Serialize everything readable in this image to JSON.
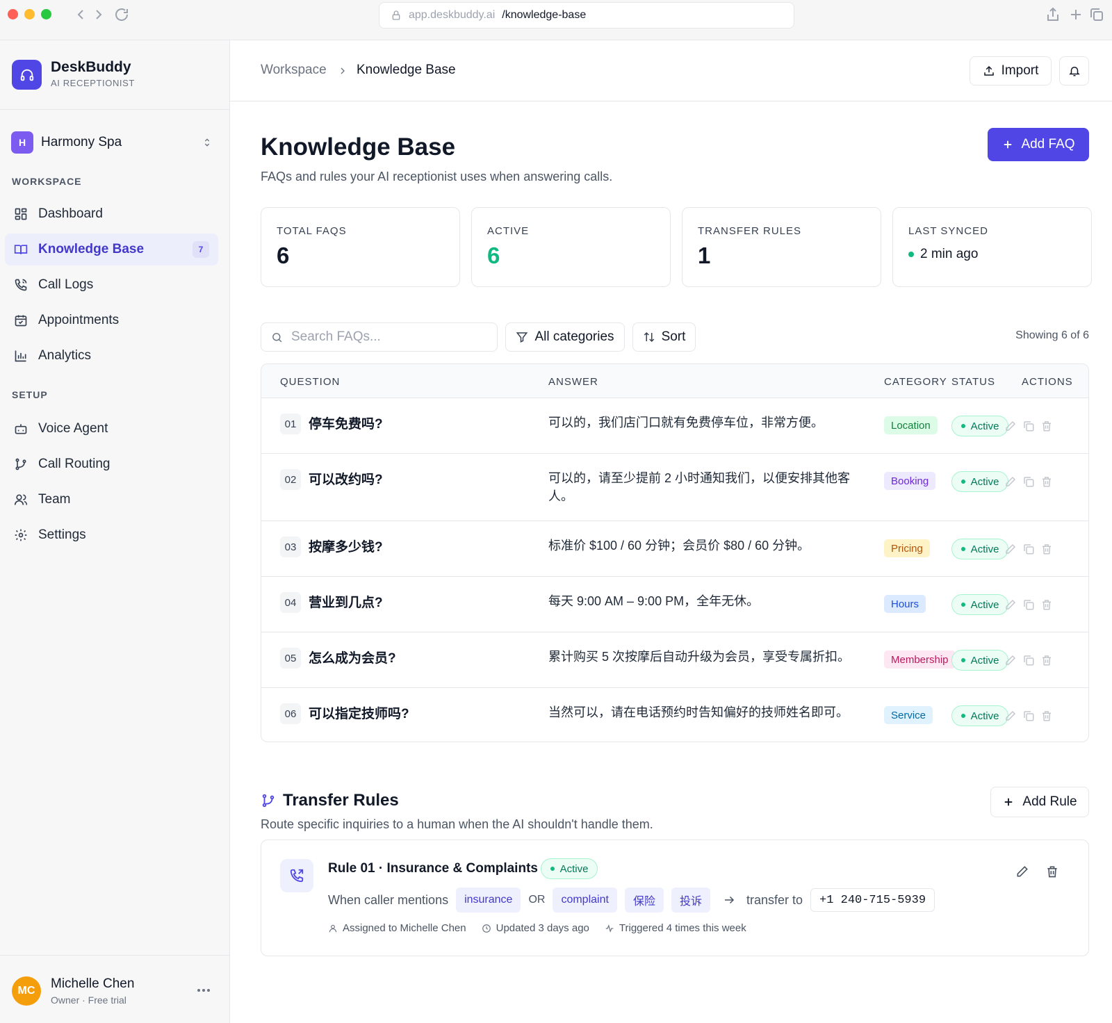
{
  "browser": {
    "url_host": "app.deskbuddy.ai",
    "url_path": "/knowledge-base"
  },
  "sidebar": {
    "brand": {
      "name": "DeskBuddy",
      "subtitle": "AI RECEPTIONIST"
    },
    "org": {
      "initial": "H",
      "name": "Harmony Spa"
    },
    "workspace_label": "WORKSPACE",
    "setup_label": "SETUP",
    "workspace_items": [
      {
        "label": "Dashboard",
        "icon": "dashboard-icon"
      },
      {
        "label": "Knowledge Base",
        "icon": "book-icon",
        "badge": "7",
        "active": true
      },
      {
        "label": "Call Logs",
        "icon": "phone-icon"
      },
      {
        "label": "Appointments",
        "icon": "calendar-icon"
      },
      {
        "label": "Analytics",
        "icon": "bar-chart-icon"
      }
    ],
    "setup_items": [
      {
        "label": "Voice Agent",
        "icon": "bot-icon"
      },
      {
        "label": "Call Routing",
        "icon": "git-branch-icon"
      },
      {
        "label": "Team",
        "icon": "users-icon"
      },
      {
        "label": "Settings",
        "icon": "gear-icon"
      }
    ],
    "user": {
      "initials": "MC",
      "name": "Michelle Chen",
      "role": "Owner · Free trial"
    }
  },
  "header": {
    "breadcrumb": [
      "Workspace",
      "Knowledge Base"
    ],
    "import_label": "Import"
  },
  "page": {
    "title": "Knowledge Base",
    "subtitle": "FAQs and rules your AI receptionist uses when answering calls.",
    "add_faq_label": "Add FAQ"
  },
  "stats": [
    {
      "label": "TOTAL FAQS",
      "value": "6"
    },
    {
      "label": "ACTIVE",
      "value": "6"
    },
    {
      "label": "TRANSFER RULES",
      "value": "1"
    },
    {
      "label": "LAST SYNCED",
      "value": "2 min ago"
    }
  ],
  "toolbar": {
    "search_placeholder": "Search FAQs...",
    "filter_label": "All categories",
    "sort_label": "Sort",
    "showing": "Showing 6 of 6"
  },
  "table": {
    "columns": [
      "QUESTION",
      "ANSWER",
      "CATEGORY",
      "STATUS",
      "ACTIONS"
    ],
    "rows": [
      {
        "num": "01",
        "question": "停车免费吗?",
        "answer": "可以的，我们店门口就有免费停车位，非常方便。",
        "category": "Location",
        "status": "Active"
      },
      {
        "num": "02",
        "question": "可以改约吗?",
        "answer": "可以的，请至少提前 2 小时通知我们，以便安排其他客人。",
        "category": "Booking",
        "status": "Active"
      },
      {
        "num": "03",
        "question": "按摩多少钱?",
        "answer": "标准价 $100 / 60 分钟；会员价 $80 / 60 分钟。",
        "category": "Pricing",
        "status": "Active"
      },
      {
        "num": "04",
        "question": "营业到几点?",
        "answer": "每天 9:00 AM – 9:00 PM，全年无休。",
        "category": "Hours",
        "status": "Active"
      },
      {
        "num": "05",
        "question": "怎么成为会员?",
        "answer": "累计购买 5 次按摩后自动升级为会员，享受专属折扣。",
        "category": "Membership",
        "status": "Active"
      },
      {
        "num": "06",
        "question": "可以指定技师吗?",
        "answer": "当然可以，请在电话预约时告知偏好的技师姓名即可。",
        "category": "Service",
        "status": "Active"
      }
    ]
  },
  "transfer_rules": {
    "title": "Transfer Rules",
    "subtitle": "Route specific inquiries to a human when the AI shouldn't handle them.",
    "add_rule_label": "Add Rule",
    "rules": [
      {
        "title": "Rule 01 · Insurance & Complaints",
        "status": "Active",
        "when_label": "When caller mentions",
        "keywords": [
          "insurance",
          "complaint",
          "保险",
          "投诉"
        ],
        "or_label": "OR",
        "transfer_label": "transfer to",
        "phone": "+1 240-715-5939",
        "assigned": "Assigned to Michelle Chen",
        "updated": "Updated 3 days ago",
        "triggered": "Triggered 4 times this week"
      }
    ]
  },
  "colors": {
    "accent": "#4f46e5",
    "success": "#10b981"
  }
}
